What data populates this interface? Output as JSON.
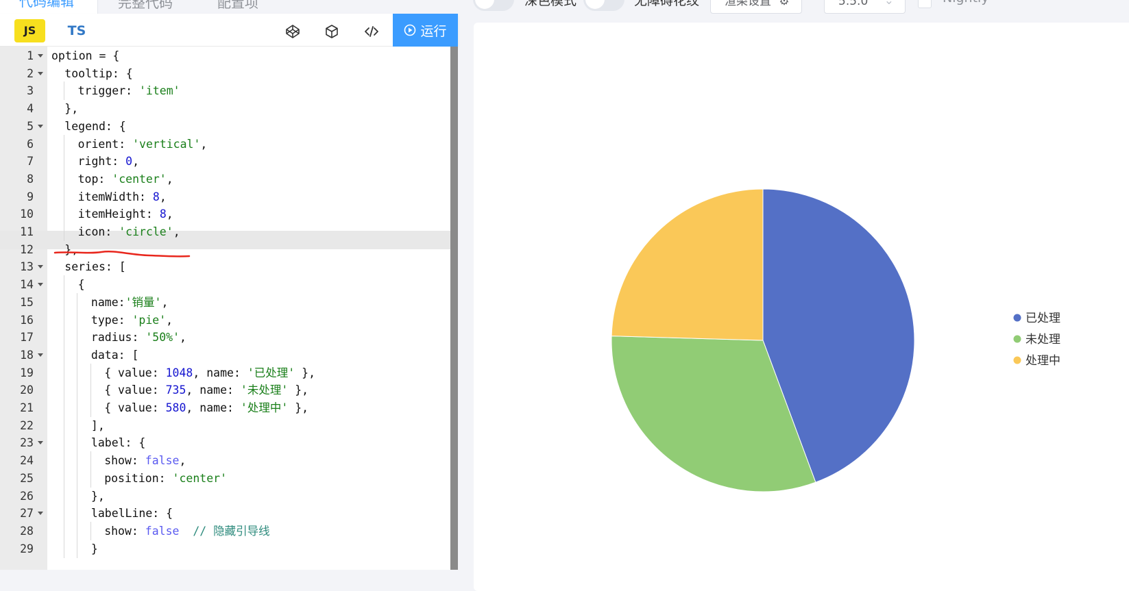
{
  "tabs": [
    {
      "label": "代码编辑",
      "active": true
    },
    {
      "label": "完整代码",
      "active": false
    },
    {
      "label": "配置项",
      "active": false
    }
  ],
  "toolbar": {
    "js_label": "JS",
    "ts_label": "TS",
    "run_label": "运行",
    "icons": [
      "codepen-icon",
      "codesandbox-icon",
      "code-embed-icon"
    ]
  },
  "editor": {
    "highlighted_line": 11,
    "lines": [
      {
        "n": "1",
        "fold": true,
        "indent": 0,
        "tokens": [
          [
            "t",
            "option = {"
          ]
        ]
      },
      {
        "n": "2",
        "fold": true,
        "indent": 1,
        "tokens": [
          [
            "t",
            "tooltip: {"
          ]
        ]
      },
      {
        "n": "3",
        "fold": false,
        "indent": 2,
        "tokens": [
          [
            "t",
            "trigger: "
          ],
          [
            "s",
            "'item'"
          ]
        ]
      },
      {
        "n": "4",
        "fold": false,
        "indent": 1,
        "tokens": [
          [
            "t",
            "},"
          ]
        ]
      },
      {
        "n": "5",
        "fold": true,
        "indent": 1,
        "tokens": [
          [
            "t",
            "legend: {"
          ]
        ]
      },
      {
        "n": "6",
        "fold": false,
        "indent": 2,
        "tokens": [
          [
            "t",
            "orient: "
          ],
          [
            "s",
            "'vertical'"
          ],
          [
            "t",
            ","
          ]
        ]
      },
      {
        "n": "7",
        "fold": false,
        "indent": 2,
        "tokens": [
          [
            "t",
            "right: "
          ],
          [
            "n",
            "0"
          ],
          [
            "t",
            ","
          ]
        ]
      },
      {
        "n": "8",
        "fold": false,
        "indent": 2,
        "tokens": [
          [
            "t",
            "top: "
          ],
          [
            "s",
            "'center'"
          ],
          [
            "t",
            ","
          ]
        ]
      },
      {
        "n": "9",
        "fold": false,
        "indent": 2,
        "tokens": [
          [
            "t",
            "itemWidth: "
          ],
          [
            "n",
            "8"
          ],
          [
            "t",
            ","
          ]
        ]
      },
      {
        "n": "10",
        "fold": false,
        "indent": 2,
        "tokens": [
          [
            "t",
            "itemHeight: "
          ],
          [
            "n",
            "8"
          ],
          [
            "t",
            ","
          ]
        ]
      },
      {
        "n": "11",
        "fold": false,
        "indent": 2,
        "tokens": [
          [
            "t",
            "icon: "
          ],
          [
            "s",
            "'circle'"
          ],
          [
            "t",
            ","
          ]
        ]
      },
      {
        "n": "12",
        "fold": false,
        "indent": 1,
        "tokens": [
          [
            "t",
            "},"
          ]
        ]
      },
      {
        "n": "13",
        "fold": true,
        "indent": 1,
        "tokens": [
          [
            "t",
            "series: ["
          ]
        ]
      },
      {
        "n": "14",
        "fold": true,
        "indent": 2,
        "tokens": [
          [
            "t",
            "{"
          ]
        ]
      },
      {
        "n": "15",
        "fold": false,
        "indent": 3,
        "tokens": [
          [
            "t",
            "name:"
          ],
          [
            "s",
            "'销量'"
          ],
          [
            "t",
            ","
          ]
        ]
      },
      {
        "n": "16",
        "fold": false,
        "indent": 3,
        "tokens": [
          [
            "t",
            "type: "
          ],
          [
            "s",
            "'pie'"
          ],
          [
            "t",
            ","
          ]
        ]
      },
      {
        "n": "17",
        "fold": false,
        "indent": 3,
        "tokens": [
          [
            "t",
            "radius: "
          ],
          [
            "s",
            "'50%'"
          ],
          [
            "t",
            ","
          ]
        ]
      },
      {
        "n": "18",
        "fold": true,
        "indent": 3,
        "tokens": [
          [
            "t",
            "data: ["
          ]
        ]
      },
      {
        "n": "19",
        "fold": false,
        "indent": 4,
        "tokens": [
          [
            "t",
            "{ value: "
          ],
          [
            "n",
            "1048"
          ],
          [
            "t",
            ", name: "
          ],
          [
            "s",
            "'已处理'"
          ],
          [
            "t",
            " },"
          ]
        ]
      },
      {
        "n": "20",
        "fold": false,
        "indent": 4,
        "tokens": [
          [
            "t",
            "{ value: "
          ],
          [
            "n",
            "735"
          ],
          [
            "t",
            ", name: "
          ],
          [
            "s",
            "'未处理'"
          ],
          [
            "t",
            " },"
          ]
        ]
      },
      {
        "n": "21",
        "fold": false,
        "indent": 4,
        "tokens": [
          [
            "t",
            "{ value: "
          ],
          [
            "n",
            "580"
          ],
          [
            "t",
            ", name: "
          ],
          [
            "s",
            "'处理中'"
          ],
          [
            "t",
            " },"
          ]
        ]
      },
      {
        "n": "22",
        "fold": false,
        "indent": 3,
        "tokens": [
          [
            "t",
            "],"
          ]
        ]
      },
      {
        "n": "23",
        "fold": true,
        "indent": 3,
        "tokens": [
          [
            "t",
            "label: {"
          ]
        ]
      },
      {
        "n": "24",
        "fold": false,
        "indent": 4,
        "tokens": [
          [
            "t",
            "show: "
          ],
          [
            "b",
            "false"
          ],
          [
            "t",
            ","
          ]
        ]
      },
      {
        "n": "25",
        "fold": false,
        "indent": 4,
        "tokens": [
          [
            "t",
            "position: "
          ],
          [
            "s",
            "'center'"
          ]
        ]
      },
      {
        "n": "26",
        "fold": false,
        "indent": 3,
        "tokens": [
          [
            "t",
            "},"
          ]
        ]
      },
      {
        "n": "27",
        "fold": true,
        "indent": 3,
        "tokens": [
          [
            "t",
            "labelLine: {"
          ]
        ]
      },
      {
        "n": "28",
        "fold": false,
        "indent": 4,
        "tokens": [
          [
            "t",
            "show: "
          ],
          [
            "b",
            "false"
          ],
          [
            "t",
            "  "
          ],
          [
            "c",
            "// 隐藏引导线"
          ]
        ]
      },
      {
        "n": "29",
        "fold": false,
        "indent": 3,
        "tokens": [
          [
            "t",
            "}"
          ]
        ]
      }
    ]
  },
  "controls": {
    "dark_mode_label": "深色模式",
    "a11y_label": "无障碍花纹",
    "render_settings_label": "渲染设置",
    "version_value": "5.5.0",
    "nightly_label": "Nightly"
  },
  "chart_data": {
    "type": "pie",
    "series": [
      {
        "values": [
          {
            "name": "已处理",
            "value": 1048,
            "color": "#5470c6"
          },
          {
            "name": "未处理",
            "value": 735,
            "color": "#91cc75"
          },
          {
            "name": "处理中",
            "value": 580,
            "color": "#fac858"
          }
        ]
      }
    ],
    "legend": {
      "position": "right",
      "orient": "vertical",
      "icon": "circle"
    }
  },
  "colors": {
    "accent": "#409eff",
    "run_button": "#3b9cff",
    "js_badge": "#f7df1e",
    "annotation": "#e8261c"
  }
}
